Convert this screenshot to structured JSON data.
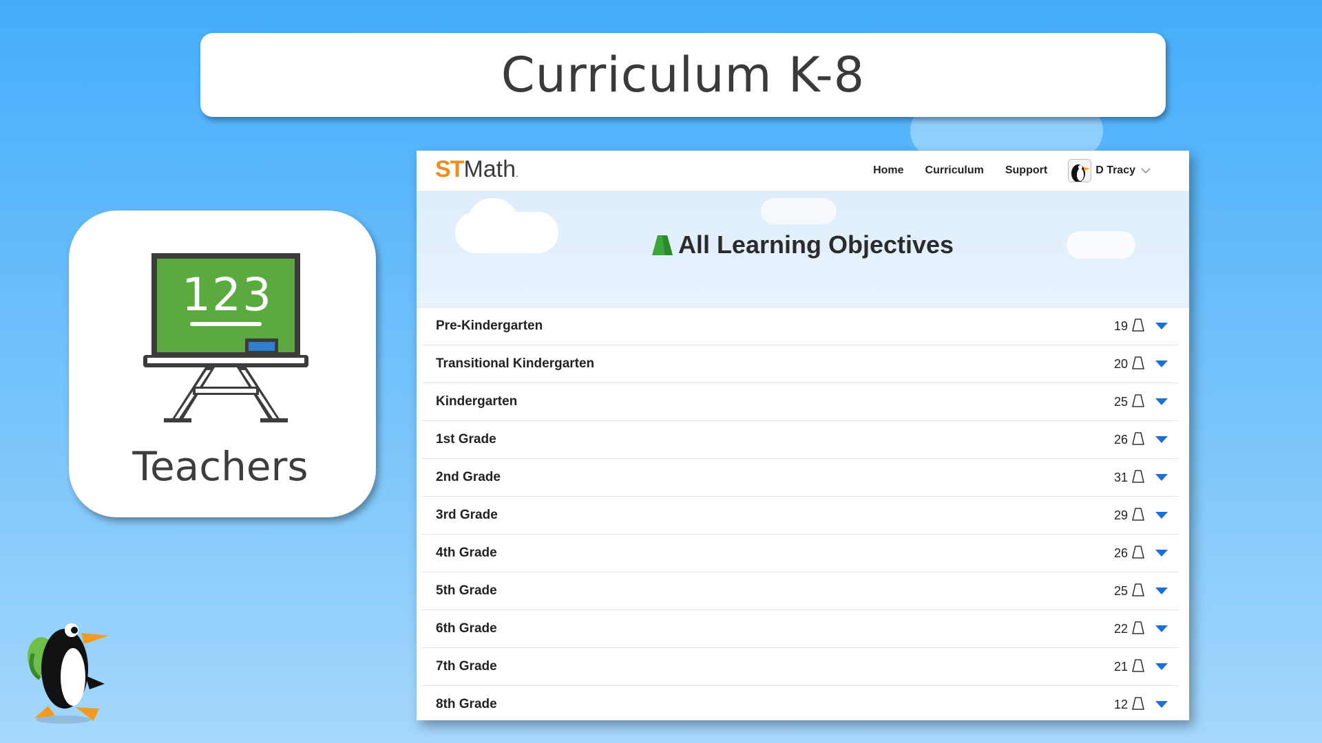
{
  "slide_title": "Curriculum K-8",
  "teachers_card": {
    "board_text": "123",
    "label": "Teachers",
    "colors": {
      "board": "#5aaa3f",
      "frame": "#3c3c3c",
      "eraser": "#2f7fcf"
    }
  },
  "app": {
    "logo": {
      "st": "ST",
      "math": "Math",
      "registered": "."
    },
    "nav": {
      "home": "Home",
      "curriculum": "Curriculum",
      "support": "Support"
    },
    "user": {
      "name": "D Tracy",
      "avatar_icon": "penguin-avatar-icon"
    },
    "page_title": "All Learning Objectives",
    "page_title_icon": "green-objective-flag-icon",
    "objectives": [
      {
        "label": "Pre-Kindergarten",
        "count": "19"
      },
      {
        "label": "Transitional Kindergarten",
        "count": "20"
      },
      {
        "label": "Kindergarten",
        "count": "25"
      },
      {
        "label": "1st Grade",
        "count": "26"
      },
      {
        "label": "2nd Grade",
        "count": "31"
      },
      {
        "label": "3rd Grade",
        "count": "29"
      },
      {
        "label": "4th Grade",
        "count": "26"
      },
      {
        "label": "5th Grade",
        "count": "25"
      },
      {
        "label": "6th Grade",
        "count": "22"
      },
      {
        "label": "7th Grade",
        "count": "21"
      },
      {
        "label": "8th Grade",
        "count": "12"
      }
    ],
    "colors": {
      "accent_orange": "#f08c1c",
      "toggle_blue": "#1c6fd8",
      "objective_green": "#3aa63a"
    }
  }
}
